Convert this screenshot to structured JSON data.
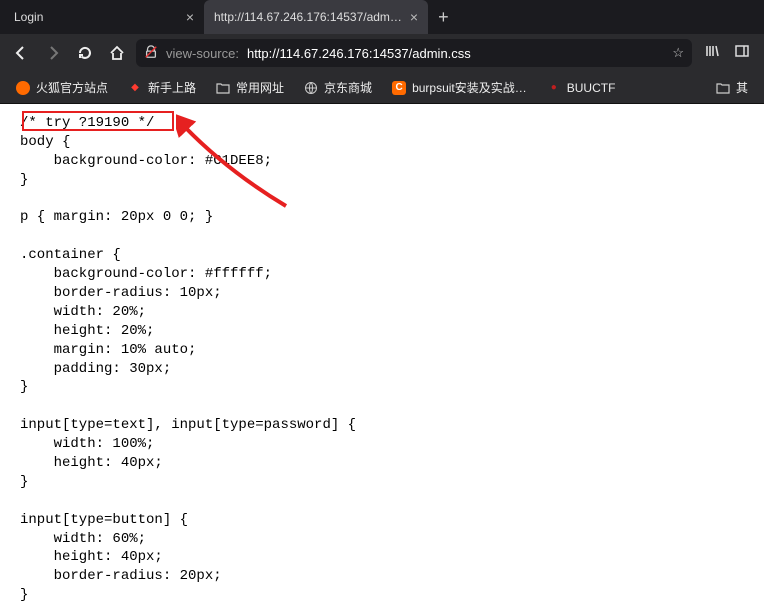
{
  "tabs": [
    {
      "title": "Login",
      "active": false
    },
    {
      "title": "http://114.67.246.176:14537/adm…",
      "active": true
    }
  ],
  "nav": {
    "url_prefix": "view-source:",
    "url_main": "http://114.67.246.176:14537/admin.css"
  },
  "bookmarks": [
    {
      "label": "火狐官方站点",
      "icon": "fox",
      "color": "#ff6a00"
    },
    {
      "label": "新手上路",
      "icon": "diamond",
      "color": "#ff3b30"
    },
    {
      "label": "常用网址",
      "icon": "folder",
      "color": "#ccc"
    },
    {
      "label": "京东商城",
      "icon": "globe",
      "color": "#ccc"
    },
    {
      "label": "burpsuit安装及实战…",
      "icon": "C",
      "color": "#ff6a00"
    },
    {
      "label": "BUUCTF",
      "icon": "dot",
      "color": "#c01f1f"
    }
  ],
  "right_bookmark": {
    "label": "其"
  },
  "source": {
    "line1": "/* try ?19190 */",
    "line2": "body {",
    "line3": "    background-color: #C1DEE8;",
    "line4": "}",
    "line5": "",
    "line6": "p { margin: 20px 0 0; }",
    "line7": "",
    "line8": ".container {",
    "line9": "    background-color: #ffffff;",
    "line10": "    border-radius: 10px;",
    "line11": "    width: 20%;",
    "line12": "    height: 20%;",
    "line13": "    margin: 10% auto;",
    "line14": "    padding: 30px;",
    "line15": "}",
    "line16": "",
    "line17": "input[type=text], input[type=password] {",
    "line18": "    width: 100%;",
    "line19": "    height: 40px;",
    "line20": "}",
    "line21": "",
    "line22": "input[type=button] {",
    "line23": "    width: 60%;",
    "line24": "    height: 40px;",
    "line25": "    border-radius: 20px;",
    "line26": "}"
  }
}
